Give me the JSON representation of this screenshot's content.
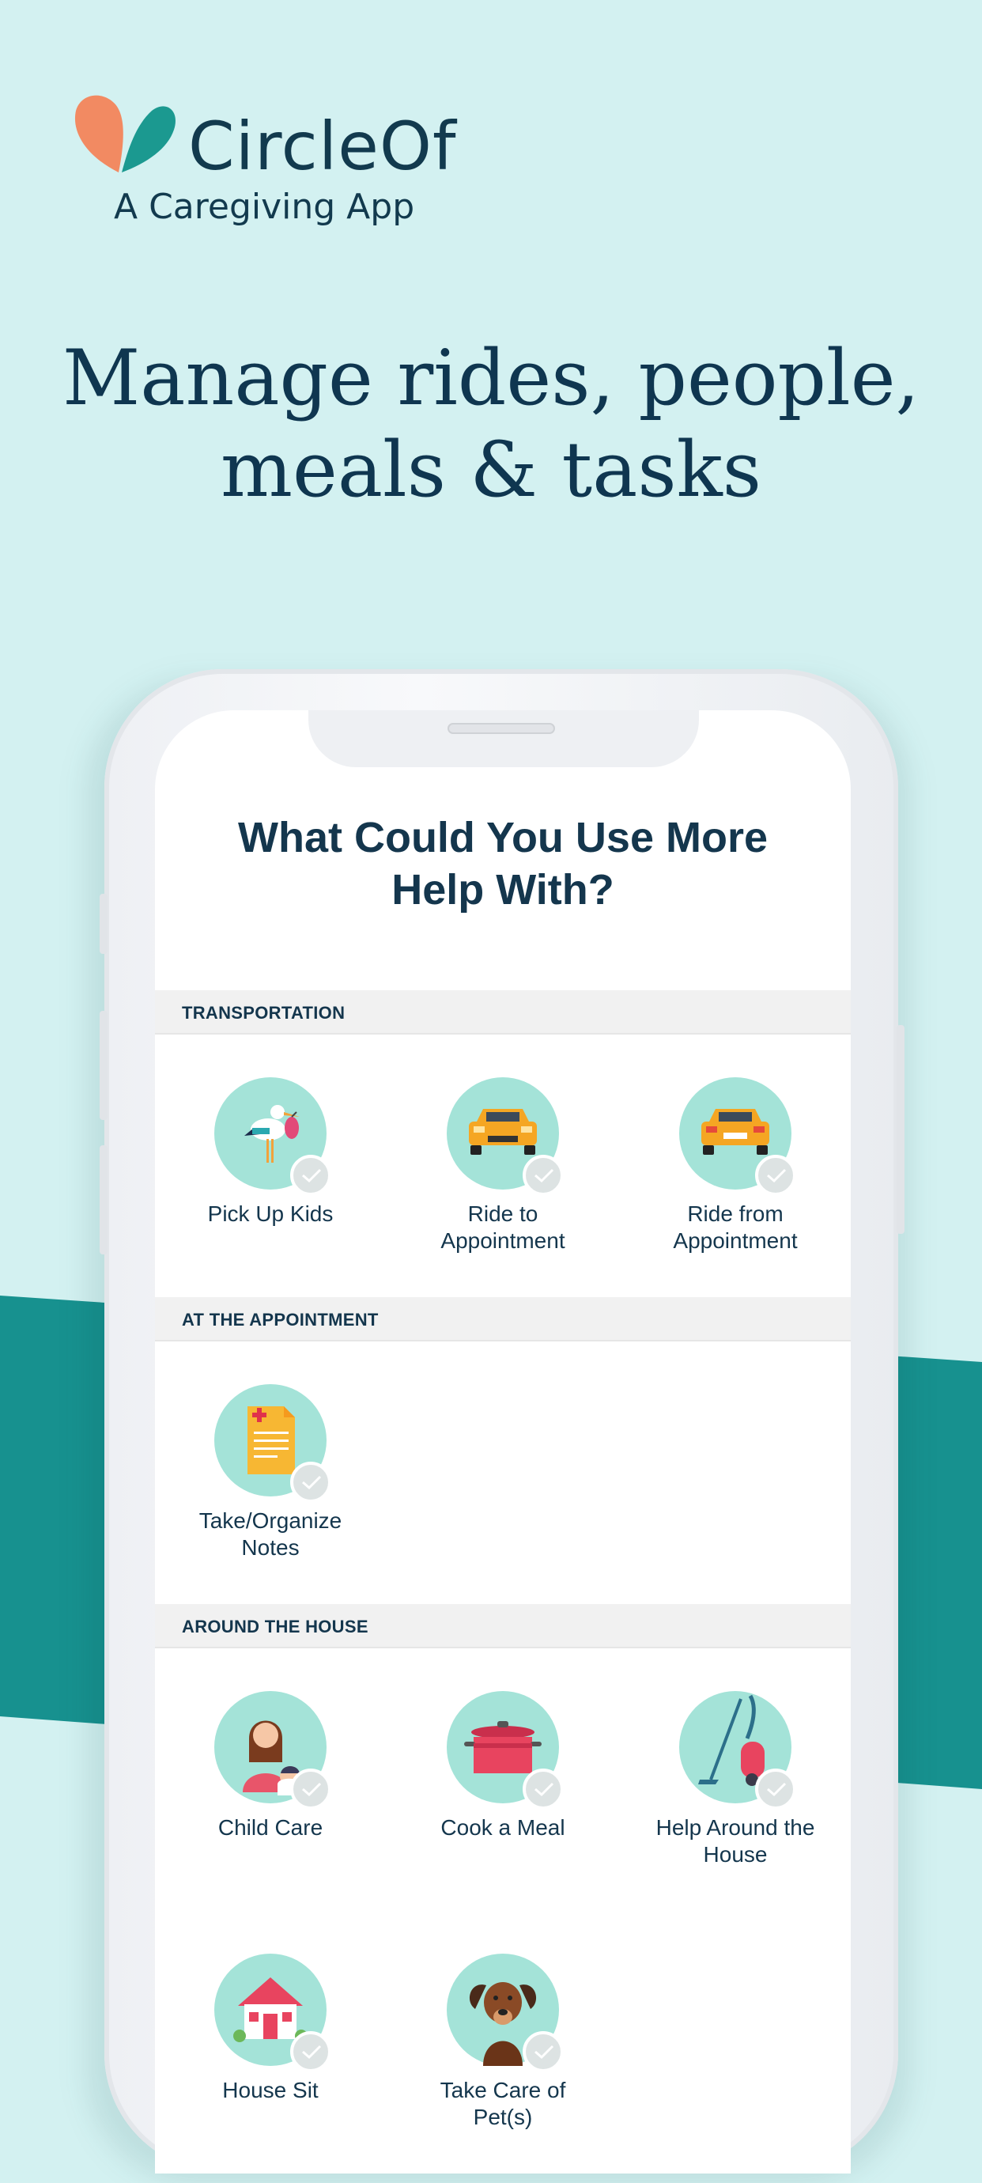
{
  "brand": {
    "name": "CircleOf",
    "tagline": "A Caregiving App"
  },
  "headline": {
    "line1": "Manage rides, people,",
    "line2": "meals & tasks"
  },
  "screen": {
    "title_line1": "What Could You Use More",
    "title_line2": "Help With?",
    "sections": [
      {
        "title": "TRANSPORTATION"
      },
      {
        "title": "AT THE APPOINTMENT"
      },
      {
        "title": "AROUND THE HOUSE"
      }
    ],
    "items": [
      {
        "label": "Pick Up Kids",
        "icon": "stork-icon"
      },
      {
        "label_line1": "Ride to",
        "label_line2": "Appointment",
        "icon": "car-icon"
      },
      {
        "label_line1": "Ride from",
        "label_line2": "Appointment",
        "icon": "car-icon"
      },
      {
        "label_line1": "Take/Organize",
        "label_line2": "Notes",
        "icon": "medical-notes-icon"
      },
      {
        "label": "Child Care",
        "icon": "mother-child-icon"
      },
      {
        "label": "Cook a Meal",
        "icon": "cooking-pot-icon"
      },
      {
        "label_line1": "Help Around the",
        "label_line2": "House",
        "icon": "vacuum-icon"
      },
      {
        "label": "House Sit",
        "icon": "house-icon"
      },
      {
        "label_line1": "Take Care of",
        "label_line2": "Pet(s)",
        "icon": "dog-icon"
      }
    ]
  },
  "colors": {
    "background": "#d3f1f1",
    "teal_band": "#17918f",
    "navy_text": "#14364d",
    "icon_circle": "#a4e3d8",
    "logo_orange": "#f28a62",
    "logo_teal": "#1b9990"
  }
}
